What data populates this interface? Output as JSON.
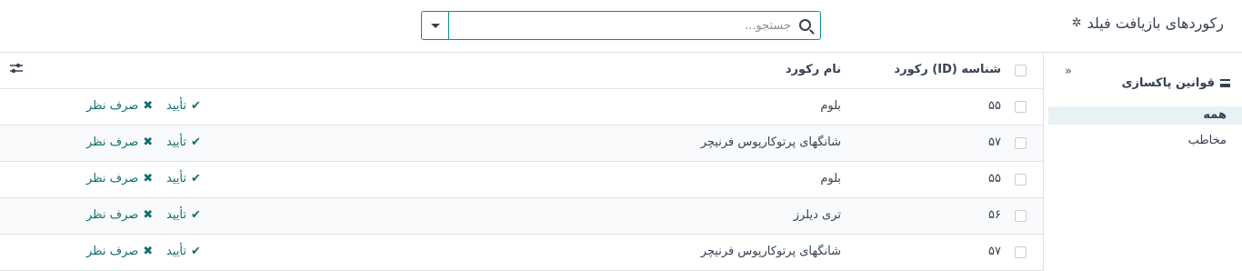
{
  "header": {
    "title": "رکوردهای بازیافت فیلد"
  },
  "search": {
    "placeholder": "جستجو..."
  },
  "sidebar": {
    "title": "قوانین پاکسازی",
    "collapse": "«",
    "items": [
      {
        "label": "همه",
        "active": true
      },
      {
        "label": "مخاطب",
        "active": false
      }
    ]
  },
  "table": {
    "columns": {
      "id": "شناسه (ID) رکورد",
      "name": "نام رکورد"
    },
    "rows": [
      {
        "id": "۵۵",
        "name": "بلوم",
        "approve": "تأیید",
        "dismiss": "صرف نظر"
      },
      {
        "id": "۵۷",
        "name": "شانگهای پرتوکارپوس فرنیچر",
        "approve": "تأیید",
        "dismiss": "صرف نظر"
      },
      {
        "id": "۵۵",
        "name": "بلوم",
        "approve": "تأیید",
        "dismiss": "صرف نظر"
      },
      {
        "id": "۵۶",
        "name": "تری دیلرز",
        "approve": "تأیید",
        "dismiss": "صرف نظر"
      },
      {
        "id": "۵۷",
        "name": "شانگهای پرتوکارپوس فرنیچر",
        "approve": "تأیید",
        "dismiss": "صرف نظر"
      }
    ]
  },
  "icons": {
    "settings": "gear-icon",
    "search": "search-icon",
    "menu": "hamburger-icon",
    "approve": "check-icon",
    "dismiss": "x-icon",
    "options": "sliders-icon"
  },
  "colors": {
    "accent": "#0f6e6e",
    "border": "#dee2e6",
    "active_bg": "#e6f2f3"
  }
}
